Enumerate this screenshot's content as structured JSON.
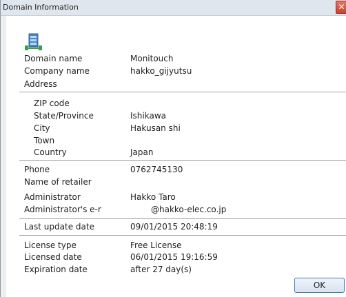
{
  "window": {
    "title": "Domain Information",
    "close_glyph": "✕"
  },
  "icon": {
    "name": "domain-server-icon",
    "colors": {
      "body": "#4a86c8",
      "accent": "#3aa04a"
    }
  },
  "fields": {
    "domain_name": {
      "label": "Domain name",
      "value": "Monitouch"
    },
    "company_name": {
      "label": "Company name",
      "value": "hakko_gijyutsu"
    },
    "address": {
      "label": "Address"
    },
    "zip_code": {
      "label": "ZIP code",
      "value": ""
    },
    "state_province": {
      "label": "State/Province",
      "value": "Ishikawa"
    },
    "city": {
      "label": "City",
      "value": "Hakusan shi"
    },
    "town": {
      "label": "Town",
      "value": ""
    },
    "country": {
      "label": "Country",
      "value": "Japan"
    },
    "phone": {
      "label": "Phone",
      "value": "0762745130"
    },
    "name_of_retailer": {
      "label": "Name of retailer",
      "value": ""
    },
    "administrator": {
      "label": "Administrator",
      "value": "Hakko Taro"
    },
    "admin_email": {
      "label": "Administrator's e-m",
      "value": "@hakko-elec.co.jp"
    },
    "last_update_date": {
      "label": "Last update date",
      "value": "09/01/2015 20:48:19"
    },
    "license_type": {
      "label": "License type",
      "value": "Free License"
    },
    "licensed_date": {
      "label": "Licensed date",
      "value": "06/01/2015 19:16:59"
    },
    "expiration_date": {
      "label": "Expiration date",
      "value": "after 27 day(s)"
    }
  },
  "buttons": {
    "ok": "OK"
  }
}
